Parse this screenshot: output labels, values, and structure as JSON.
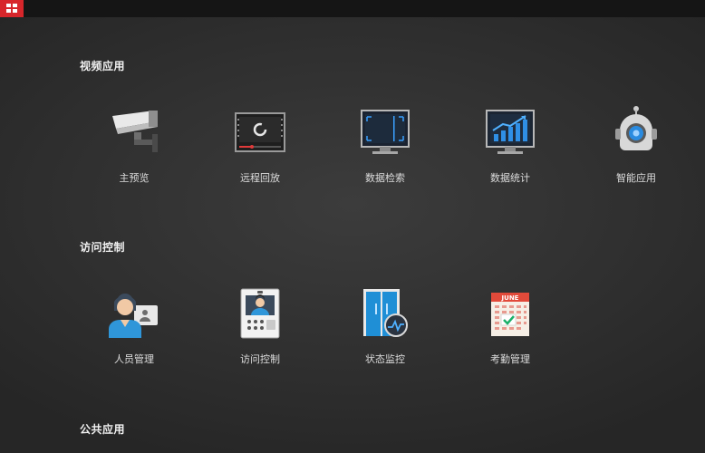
{
  "sections": [
    {
      "title": "视频应用",
      "items": [
        {
          "label": "主预览",
          "icon": "camera-icon"
        },
        {
          "label": "远程回放",
          "icon": "playback-icon"
        },
        {
          "label": "数据检索",
          "icon": "search-monitor-icon"
        },
        {
          "label": "数据统计",
          "icon": "statistics-icon"
        },
        {
          "label": "智能应用",
          "icon": "robot-icon"
        }
      ]
    },
    {
      "title": "访问控制",
      "items": [
        {
          "label": "人员管理",
          "icon": "person-card-icon"
        },
        {
          "label": "访问控制",
          "icon": "intercom-icon"
        },
        {
          "label": "状态监控",
          "icon": "door-monitor-icon"
        },
        {
          "label": "考勤管理",
          "icon": "calendar-icon"
        }
      ]
    },
    {
      "title": "公共应用",
      "items": []
    }
  ],
  "calendar_month": "JUNE",
  "colors": {
    "accent": "#d7262b",
    "topbar": "#151515",
    "background": "#303030",
    "icon_blue": "#2a8be0"
  }
}
